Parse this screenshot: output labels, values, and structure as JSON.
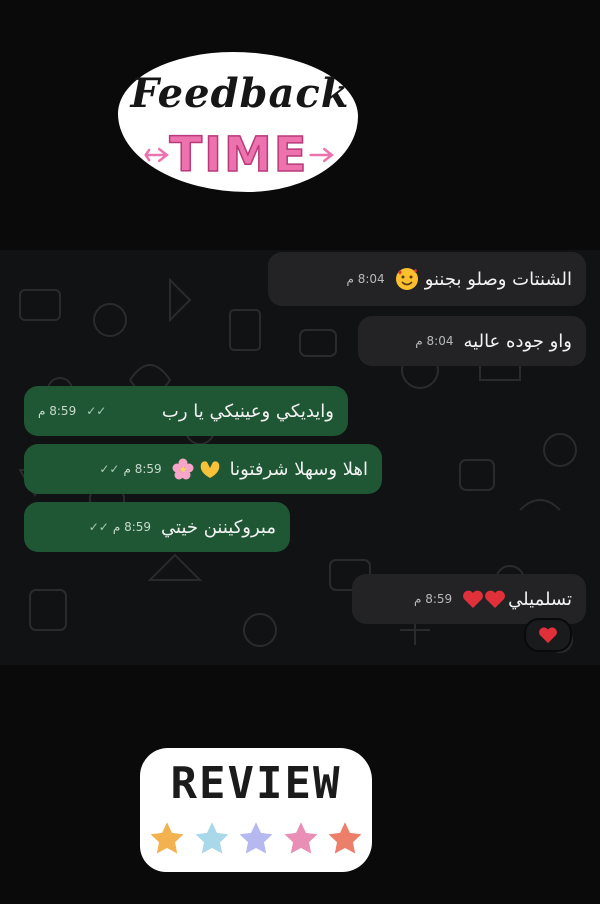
{
  "header_sticker": {
    "line1": "Feedback",
    "line2": "TIME",
    "accent": "#ec73ad"
  },
  "chat": {
    "colors": {
      "incoming": "#232326",
      "outgoing": "#1f5735",
      "background": "#111213"
    },
    "messages": [
      {
        "direction": "incoming",
        "text": "الشنتات وصلو بجننو",
        "emoji": "smiling-face-with-hearts",
        "time": "8:04 م"
      },
      {
        "direction": "incoming",
        "text": "واو جوده عاليه",
        "time": "8:04 م"
      },
      {
        "direction": "outgoing",
        "text": "وايديكي وعينيكي يا رب",
        "time": "8:59 م",
        "status": "read-double-check"
      },
      {
        "direction": "outgoing",
        "text": "اهلا وسهلا شرفتونا",
        "emoji": "heart-hands cherry-blossom",
        "time": "8:59 م",
        "status": "read-double-check"
      },
      {
        "direction": "outgoing",
        "text": "مبروكيننن خيتي",
        "time": "8:59 م",
        "status": "read-double-check"
      },
      {
        "direction": "incoming",
        "text": "تسلميلي",
        "emoji": "red-heart red-heart",
        "time": "8:59 م",
        "reaction": "red-heart"
      }
    ]
  },
  "footer_sticker": {
    "word": "REVIEW",
    "stars": [
      "#f3b14f",
      "#a8d8ea",
      "#b6b8f0",
      "#e98fb6",
      "#ec7f6a"
    ]
  }
}
